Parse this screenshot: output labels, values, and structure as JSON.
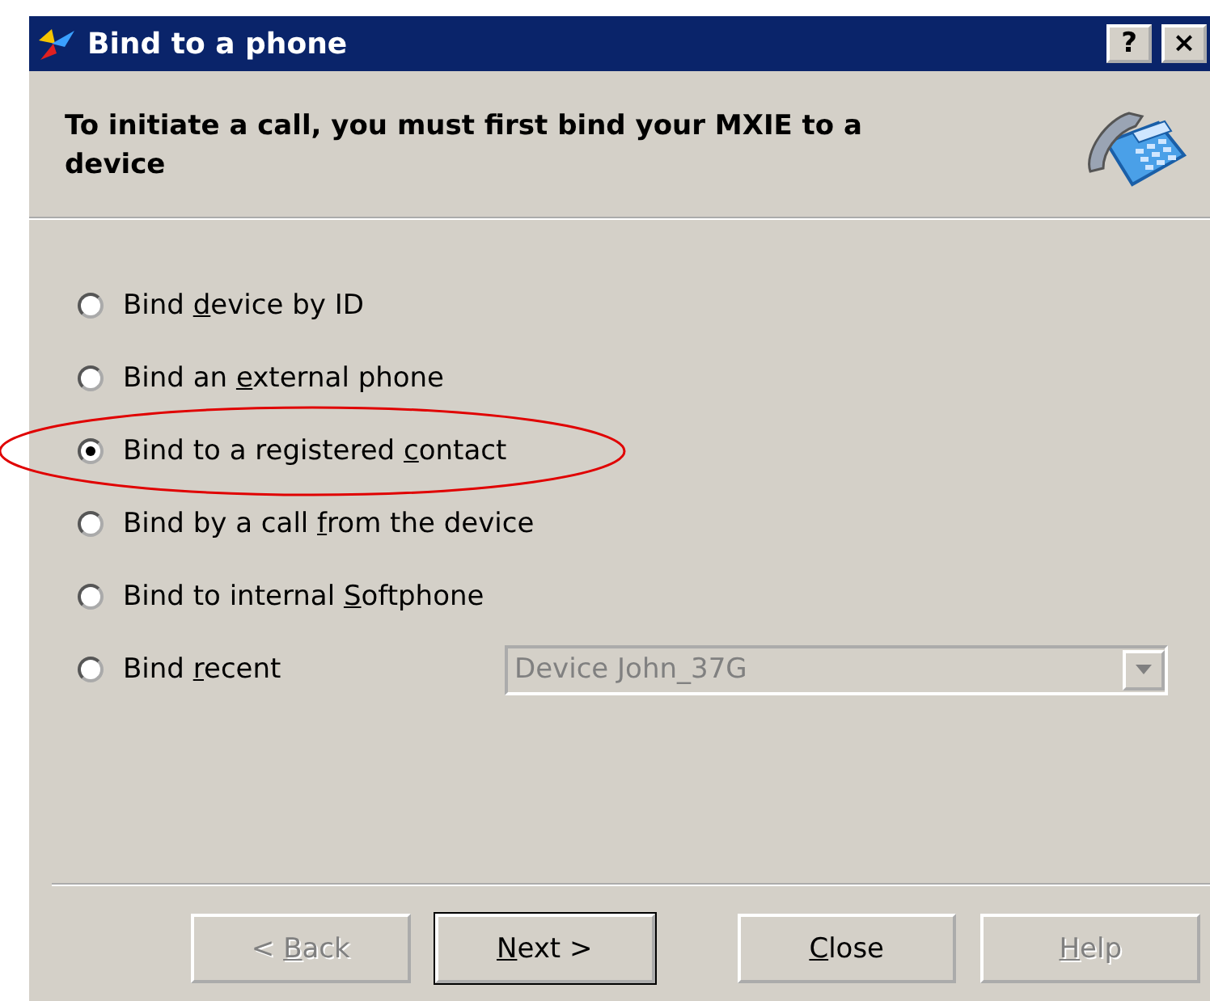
{
  "window": {
    "title": "Bind to a phone",
    "help_button": "?",
    "close_button": "×"
  },
  "header": {
    "text": "To initiate a call, you must first bind your MXIE to a device"
  },
  "options": [
    {
      "before": "Bind ",
      "key": "d",
      "after": "evice by ID",
      "selected": false,
      "circled": false
    },
    {
      "before": "Bind an ",
      "key": "e",
      "after": "xternal phone",
      "selected": false,
      "circled": false
    },
    {
      "before": "Bind to a registered ",
      "key": "c",
      "after": "ontact",
      "selected": true,
      "circled": true
    },
    {
      "before": "Bind by a call ",
      "key": "f",
      "after": "rom the device",
      "selected": false,
      "circled": false
    },
    {
      "before": "Bind to internal ",
      "key": "S",
      "after": "oftphone",
      "selected": false,
      "circled": false
    },
    {
      "before": "Bind ",
      "key": "r",
      "after": "ecent",
      "selected": false,
      "circled": false,
      "dropdown": {
        "value": "Device John_37G",
        "disabled": true
      }
    }
  ],
  "buttons": [
    {
      "before": "< ",
      "key": "B",
      "after": "ack",
      "disabled": true,
      "default": false
    },
    {
      "key": "N",
      "after": "ext  >",
      "disabled": false,
      "default": true
    },
    {
      "key": "C",
      "after": "lose",
      "disabled": false,
      "default": false
    },
    {
      "key": "H",
      "after": "elp",
      "disabled": true,
      "default": false
    }
  ]
}
